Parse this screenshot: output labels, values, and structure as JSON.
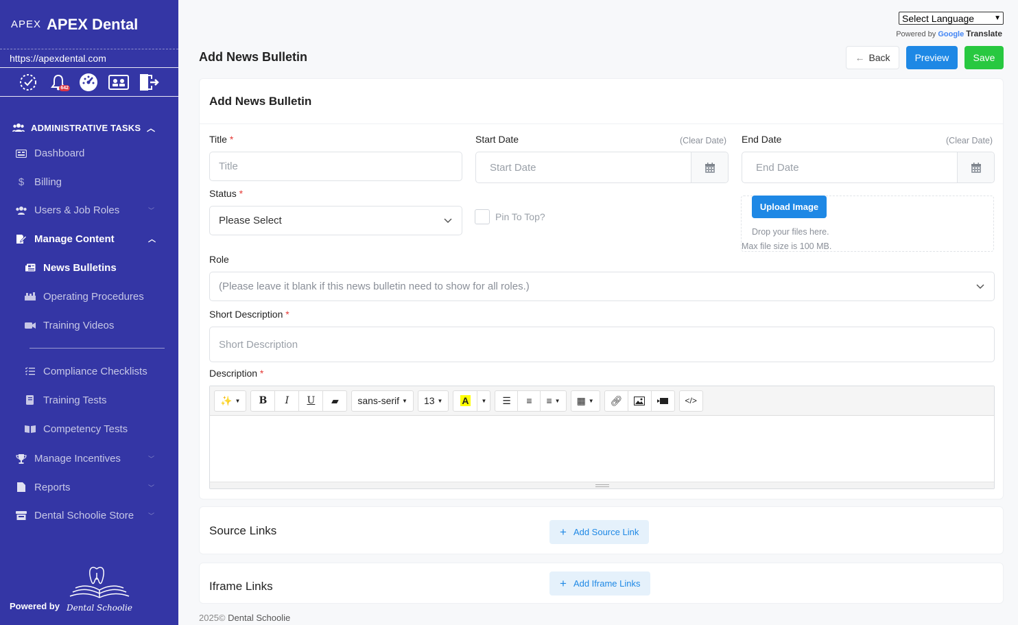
{
  "app": {
    "logo_mark": "APEX",
    "brand_name": "APEX Dental",
    "site_url": "https://apexdental.com",
    "notification_count": "642"
  },
  "sidebar": {
    "section_admin": "ADMINISTRATIVE TASKS",
    "items": [
      {
        "label": "Dashboard"
      },
      {
        "label": "Billing"
      },
      {
        "label": "Users & Job Roles"
      },
      {
        "label": "Manage Content"
      },
      {
        "label": "News Bulletins"
      },
      {
        "label": "Operating Procedures"
      },
      {
        "label": "Training Videos"
      },
      {
        "label": "Compliance Checklists"
      },
      {
        "label": "Training Tests"
      },
      {
        "label": "Competency Tests"
      },
      {
        "label": "Manage Incentives"
      },
      {
        "label": "Reports"
      },
      {
        "label": "Dental Schoolie Store"
      }
    ],
    "powered_by": "Powered by",
    "powered_logo_text": "Dental Schoolie"
  },
  "translate": {
    "select_label": "Select Language",
    "powered_by": "Powered by",
    "google": "Google",
    "translate": "Translate"
  },
  "header": {
    "title": "Add News Bulletin",
    "back": "Back",
    "preview": "Preview",
    "save": "Save"
  },
  "form": {
    "card_title": "Add News Bulletin",
    "title_label": "Title",
    "title_placeholder": "Title",
    "start_label": "Start Date",
    "start_placeholder": "Start Date",
    "end_label": "End Date",
    "end_placeholder": "End Date",
    "clear_date": "(Clear Date)",
    "status_label": "Status",
    "status_value": "Please Select",
    "pin_label": "Pin To Top?",
    "upload_button": "Upload Image",
    "drop_text": "Drop your files here.",
    "max_text": "Max file size is 100 MB.",
    "role_label": "Role",
    "role_placeholder": "(Please leave it blank if this news bulletin need to show for all roles.)",
    "short_desc_label": "Short Description",
    "short_desc_placeholder": "Short Description",
    "desc_label": "Description",
    "required_mark": "*"
  },
  "editor": {
    "font_name": "sans-serif",
    "font_size": "13",
    "code_view": "</>"
  },
  "source_links": {
    "title": "Source Links",
    "button": "Add Source Link"
  },
  "iframe_links": {
    "title": "Iframe Links",
    "button": "Add Iframe Links"
  },
  "footer": {
    "year": "2025©",
    "company": "Dental Schoolie"
  },
  "colors": {
    "sidebar": "#3436a5",
    "primary": "#1e88e5",
    "success": "#28c840",
    "required": "#e53935"
  }
}
